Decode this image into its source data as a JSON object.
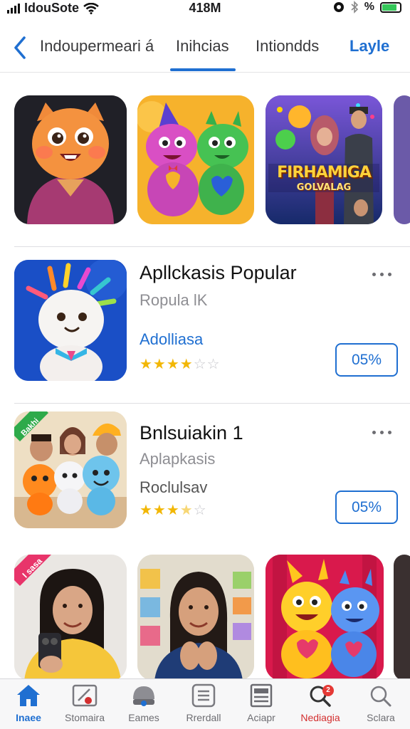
{
  "status_bar": {
    "carrier": "IdouSote",
    "time": "418M",
    "battery_percent": "%"
  },
  "nav": {
    "tabs": [
      {
        "label": "Indoupermeari á"
      },
      {
        "label": "Inihcias",
        "selected": true
      },
      {
        "label": "Intiondds"
      },
      {
        "label": "Layle"
      }
    ]
  },
  "featured_row_1": {
    "tiles": [
      {
        "name": "orange-cat-character"
      },
      {
        "name": "pink-green-mascots"
      },
      {
        "name": "game-banner",
        "caption_line1": "FIRHAMIGA",
        "caption_line2": "GOLVALAG"
      },
      {
        "name": "partial-tile"
      }
    ]
  },
  "apps": [
    {
      "title": "Apllckasis Popular",
      "subtitle": "Ropula lK",
      "link_text": "Adolliasa",
      "rating": 3.5,
      "stars_filled": 4,
      "stars_empty": 2,
      "button_label": "05%"
    },
    {
      "title": "Bnlsuiakin 1",
      "subtitle": "Aplapkasis",
      "detail": "Roclulsav",
      "rating": 2.5,
      "stars_filled": 3,
      "stars_empty": 2,
      "icon_ribbon": "Bakhi",
      "button_label": "05%"
    }
  ],
  "featured_row_2": {
    "tiles": [
      {
        "name": "woman-phone-photo",
        "ribbon": "I sasa"
      },
      {
        "name": "woman-store-photo"
      },
      {
        "name": "yellow-blue-mascots"
      },
      {
        "name": "partial-tile"
      }
    ]
  },
  "tabbar": {
    "items": [
      {
        "label": "Inaee",
        "icon": "home-icon",
        "active": true
      },
      {
        "label": "Stomaira",
        "icon": "store-icon"
      },
      {
        "label": "Eames",
        "icon": "games-icon"
      },
      {
        "label": "Rrerdall",
        "icon": "list-icon"
      },
      {
        "label": "Aciapr",
        "icon": "apps-icon"
      },
      {
        "label": "Nediagia",
        "icon": "search-alert-icon",
        "badge": "2"
      },
      {
        "label": "Sclara",
        "icon": "search-icon"
      }
    ]
  },
  "colors": {
    "accent": "#1f6fd1",
    "star": "#f2b705",
    "badge": "#e53935"
  }
}
